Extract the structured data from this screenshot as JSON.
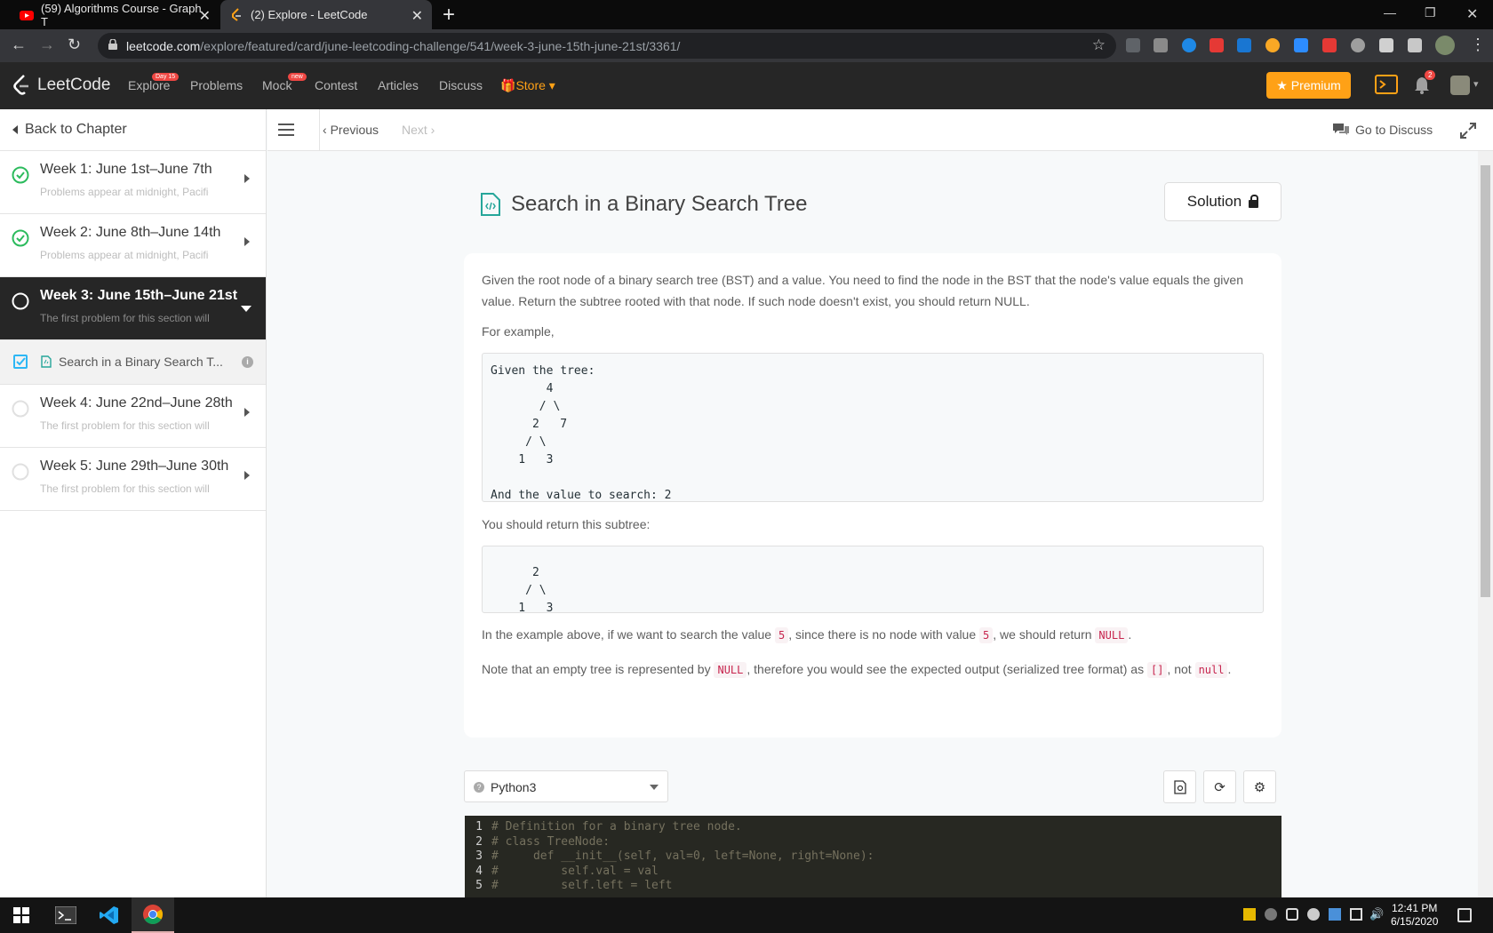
{
  "browser": {
    "tabs": [
      {
        "title": "(59) Algorithms Course - Graph T"
      },
      {
        "title": "(2) Explore - LeetCode"
      }
    ],
    "url_domain": "leetcode.com",
    "url_path": "/explore/featured/card/june-leetcoding-challenge/541/week-3-june-15th-june-21st/3361/"
  },
  "lc_nav": {
    "logo": "LeetCode",
    "explore": "Explore",
    "explore_badge": "Day 15",
    "problems": "Problems",
    "mock": "Mock",
    "mock_badge": "new",
    "contest": "Contest",
    "articles": "Articles",
    "discuss": "Discuss",
    "store": "Store",
    "premium": "Premium",
    "notification_count": "2"
  },
  "sidebar": {
    "back": "Back to Chapter",
    "weeks": [
      {
        "title": "Week 1: June 1st–June 7th",
        "subtitle": "Problems appear at midnight, Pacific"
      },
      {
        "title": "Week 2: June 8th–June 14th",
        "subtitle": "Problems appear at midnight, Pacific"
      },
      {
        "title": "Week 3: June 15th–June 21st",
        "subtitle": "The first problem for this section will"
      },
      {
        "title": "Week 4: June 22nd–June 28th",
        "subtitle": "The first problem for this section will"
      },
      {
        "title": "Week 5: June 29th–June 30th",
        "subtitle": "The first problem for this section will"
      }
    ],
    "lesson": "Search in a Binary Search T..."
  },
  "subbar": {
    "previous": "Previous",
    "next": "Next",
    "go_to_discuss": "Go to Discuss"
  },
  "problem": {
    "title": "Search in a Binary Search Tree",
    "solution_label": "Solution",
    "desc_line1": "Given the root node of a binary search tree (BST) and a value. You need to find the node in the BST that the node's value equals the given",
    "desc_line2": "value. Return the subtree rooted with that node. If such node doesn't exist, you should return NULL.",
    "for_example": "For example,",
    "example1": "Given the tree:\n        4\n       / \\\n      2   7\n     / \\\n    1   3\n\nAnd the value to search: 2",
    "return_text": "You should return this subtree:",
    "example2": "\n      2\n     / \\\n    1   3",
    "p3_a": "In the example above, if we want to search the value ",
    "p3_code1": "5",
    "p3_b": ", since there is no node with value ",
    "p3_code2": "5",
    "p3_c": ", we should return ",
    "p3_code3": "NULL",
    "p3_d": ".",
    "p4_a": "Note that an empty tree is represented by ",
    "p4_code1": "NULL",
    "p4_b": ", therefore you would see the expected output (serialized tree format) as ",
    "p4_code2": "[]",
    "p4_c": ", not ",
    "p4_code3": "null",
    "p4_d": "."
  },
  "editor": {
    "language": "Python3",
    "lines": [
      {
        "n": "1",
        "text": "# Definition for a binary tree node."
      },
      {
        "n": "2",
        "text": "# class TreeNode:"
      },
      {
        "n": "3",
        "text": "#     def __init__(self, val=0, left=None, right=None):"
      },
      {
        "n": "4",
        "text": "#         self.val = val"
      },
      {
        "n": "5",
        "text": "#         self.left = left"
      }
    ]
  },
  "taskbar": {
    "time": "12:41 PM",
    "date": "6/15/2020"
  },
  "colors": {
    "accent_orange": "#ffa116",
    "success_green": "#2cbb5d",
    "code_red": "#c7254e"
  }
}
